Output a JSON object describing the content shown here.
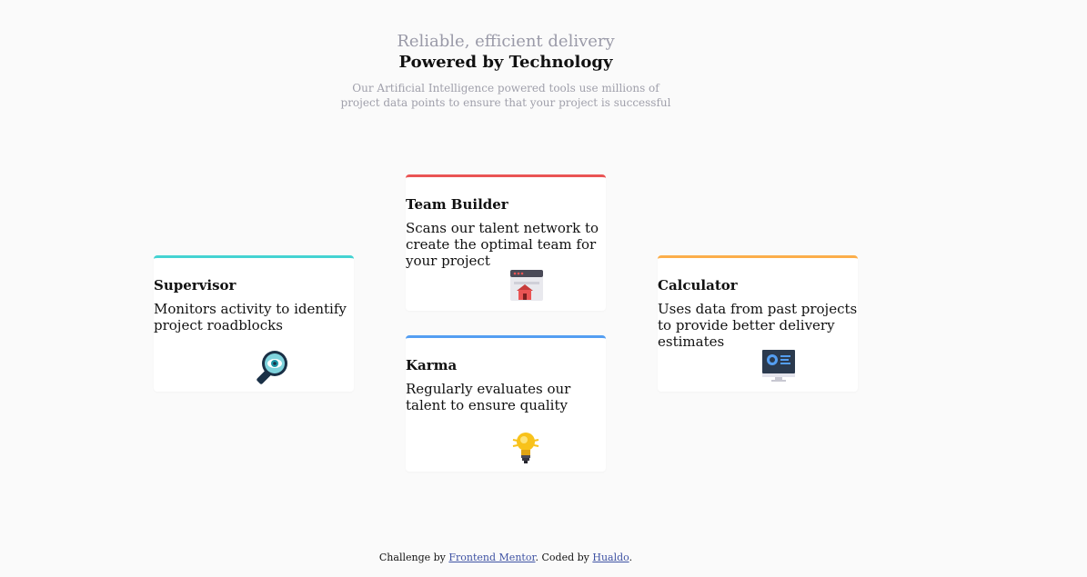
{
  "header": {
    "kicker": "Reliable, efficient delivery",
    "title": "Powered by Technology",
    "subtitle": "Our Artificial Intelligence powered tools use millions of project data points to ensure that your project is successful"
  },
  "cards": [
    {
      "title": "Supervisor",
      "text": "Monitors activity to identify project roadblocks",
      "accent": "#44d3d2",
      "icon": "magnifier-eye-icon"
    },
    {
      "title": "Team Builder",
      "text": "Scans our talent network to create the optimal team for your project",
      "accent": "#ea5454",
      "icon": "browser-house-icon"
    },
    {
      "title": "Karma",
      "text": "Regularly evaluates our talent to ensure quality",
      "accent": "#549ef2",
      "icon": "lightbulb-icon"
    },
    {
      "title": "Calculator",
      "text": "Uses data from past projects to provide better delivery estimates",
      "accent": "#fcae4a",
      "icon": "monitor-dashboard-icon"
    }
  ],
  "footer": {
    "prefix": "Challenge by ",
    "link1": "Frontend Mentor",
    "middle": ". Coded by ",
    "link2": "Hualdo",
    "suffix": "."
  }
}
